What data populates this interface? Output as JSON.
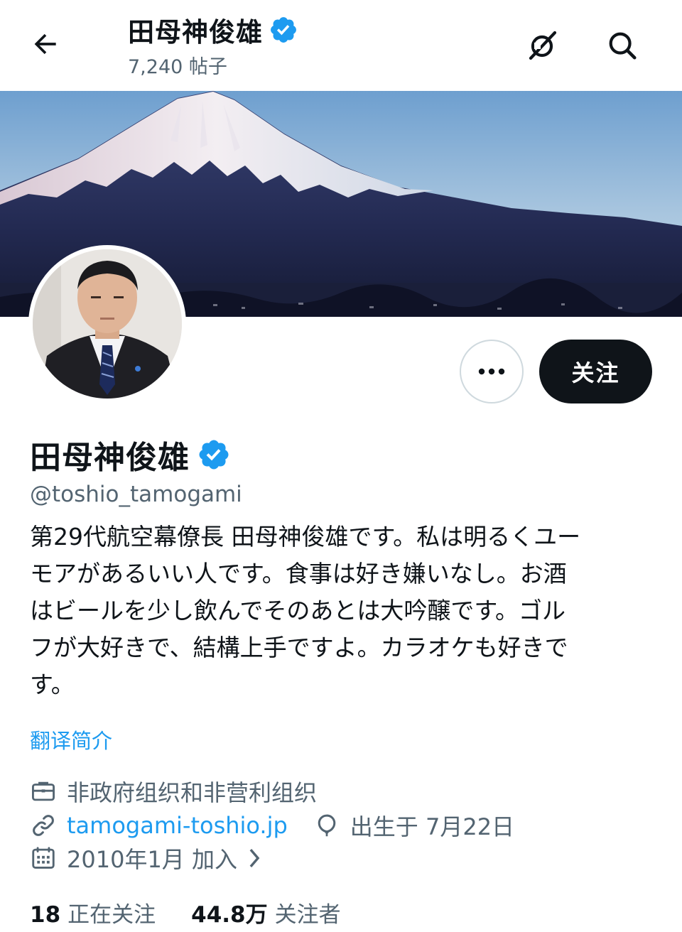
{
  "header": {
    "name": "田母神俊雄",
    "posts_count": "7,240 帖子"
  },
  "actions": {
    "follow_label": "关注"
  },
  "profile": {
    "name": "田母神俊雄",
    "handle": "@toshio_tamogami",
    "bio_lines": [
      "第29代航空幕僚長 田母神俊雄です。私は明るくユー",
      "モアがあるいい人です。食事は好き嫌いなし。お酒",
      "はビールを少し飲んでそのあとは大吟醸です。ゴル",
      "フが大好きで、結構上手ですよ。カラオケも好きで",
      "す。"
    ],
    "translate_label": "翻译简介",
    "category": "非政府组织和非营利组织",
    "website": "tamogami-toshio.jp",
    "birthday": "出生于 7月22日",
    "joined": "2010年1月 加入"
  },
  "stats": {
    "following_count": "18",
    "following_label": "正在关注",
    "followers_count": "44.8万",
    "followers_label": "关注者"
  },
  "colors": {
    "accent_blue": "#1d9bf0",
    "text_primary": "#0f1419",
    "text_secondary": "#536471"
  },
  "icons": {
    "back": "arrow-left-icon",
    "grok": "grok-icon",
    "search": "search-icon",
    "verified": "verified-badge-icon",
    "more": "more-horizontal-icon",
    "category": "briefcase-icon",
    "website": "link-icon",
    "birthday": "balloon-icon",
    "joined": "calendar-icon"
  }
}
